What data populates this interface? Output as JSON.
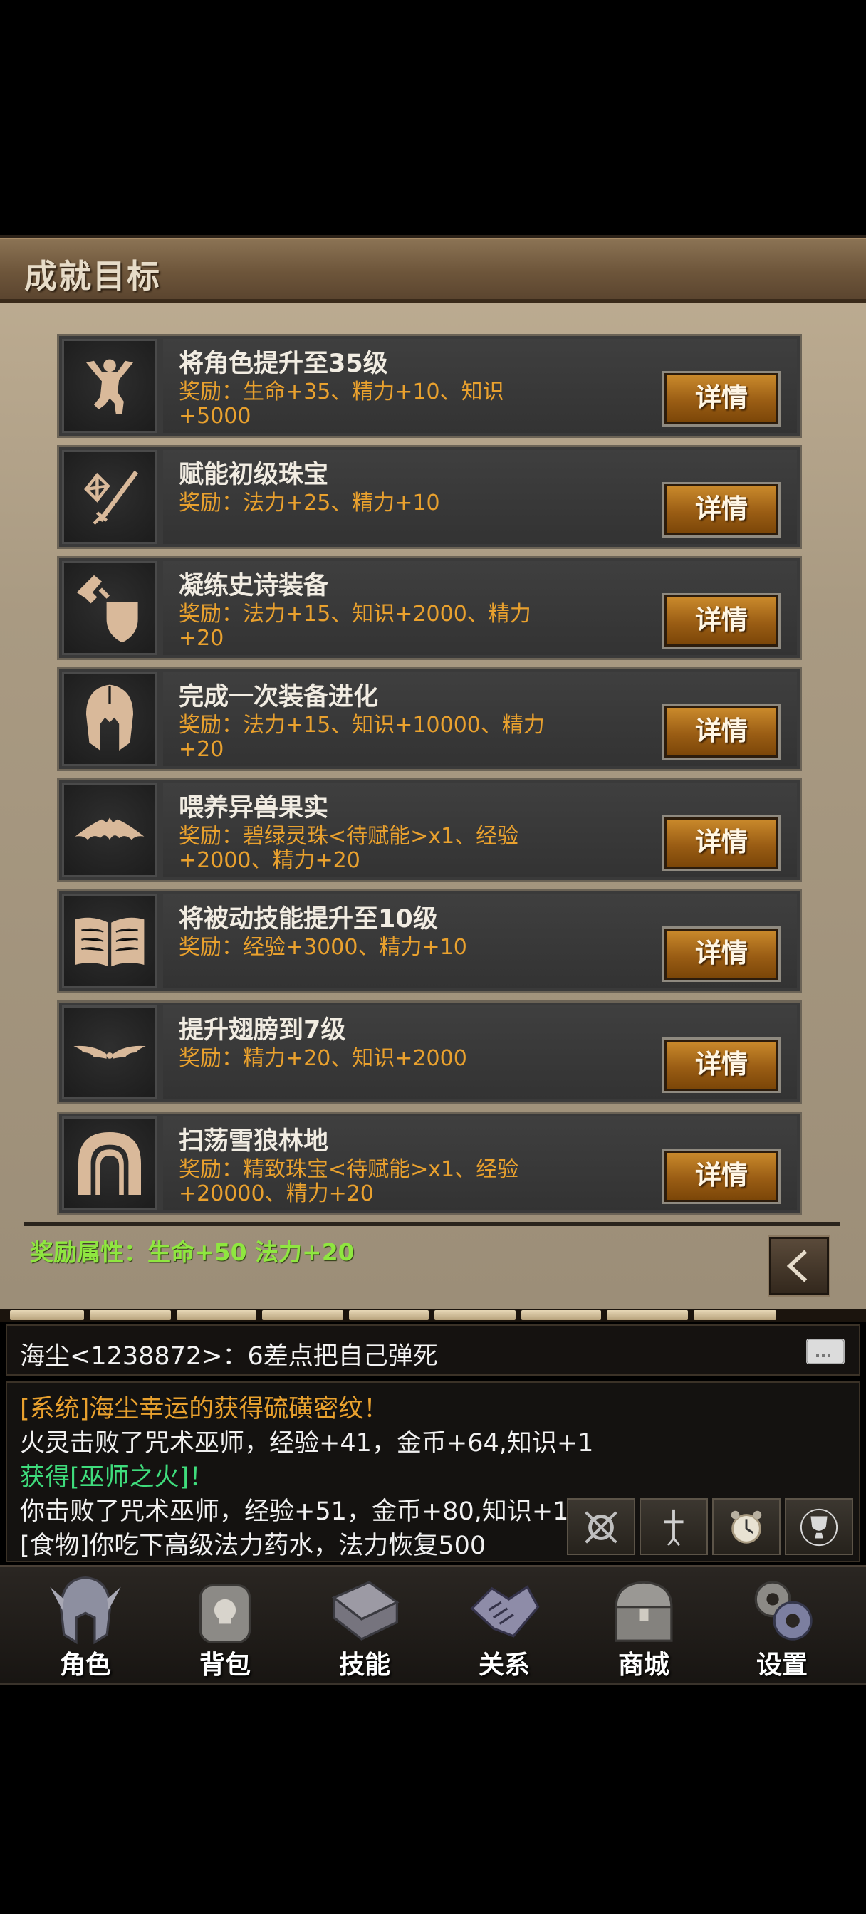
{
  "panel": {
    "title": "成就目标"
  },
  "achievements": [
    {
      "icon": "flexing-man-icon",
      "title": "将角色提升至35级",
      "reward": "奖励：生命+35、精力+10、知识+5000",
      "button": "详情"
    },
    {
      "icon": "gem-sword-icon",
      "title": "赋能初级珠宝",
      "reward": "奖励：法力+25、精力+10",
      "button": "详情"
    },
    {
      "icon": "axe-shield-icon",
      "title": "凝练史诗装备",
      "reward": "奖励：法力+15、知识+2000、精力+20",
      "button": "详情"
    },
    {
      "icon": "spartan-helmet-icon",
      "title": "完成一次装备进化",
      "reward": "奖励：法力+15、知识+10000、精力+20",
      "button": "详情"
    },
    {
      "icon": "bat-icon",
      "title": "喂养异兽果实",
      "reward": "奖励：碧绿灵珠<待赋能>x1、经验+2000、精力+20",
      "button": "详情"
    },
    {
      "icon": "open-book-icon",
      "title": "将被动技能提升至10级",
      "reward": "奖励：经验+3000、精力+10",
      "button": "详情"
    },
    {
      "icon": "wings-icon",
      "title": "提升翅膀到7级",
      "reward": "奖励：精力+20、知识+2000",
      "button": "详情"
    },
    {
      "icon": "cave-arch-icon",
      "title": "扫荡雪狼林地",
      "reward": "奖励：精致珠宝<待赋能>x1、经验+20000、精力+20",
      "button": "详情"
    }
  ],
  "bonus": "奖励属性：生命+50 法力+20",
  "chat": {
    "input_text": "海尘<1238872>：6差点把自己弹死",
    "log": [
      {
        "text": "[系统]海尘幸运的获得硫磺密纹！",
        "color": "orange"
      },
      {
        "text": "火灵击败了咒术巫师，经验+41，金币+64,知识+1",
        "color": "white"
      },
      {
        "text": "获得[巫师之火]！",
        "color": "green"
      },
      {
        "text": "你击败了咒术巫师，经验+51，金币+80,知识+1",
        "color": "white"
      },
      {
        "text": "[食物]你吃下高级法力药水，法力恢复500",
        "color": "white"
      }
    ]
  },
  "nav": {
    "items": [
      {
        "label": "角色",
        "icon": "helmet-icon"
      },
      {
        "label": "背包",
        "icon": "backpack-icon"
      },
      {
        "label": "技能",
        "icon": "spellbook-icon"
      },
      {
        "label": "关系",
        "icon": "handshake-icon"
      },
      {
        "label": "商城",
        "icon": "treasure-chest-icon"
      },
      {
        "label": "设置",
        "icon": "gears-icon"
      }
    ]
  },
  "colors": {
    "reward": "#e9a12e",
    "bonus": "#8fe640",
    "system": "#e9a12e",
    "loot": "#3fdc7c",
    "button": "#9a5d14"
  }
}
